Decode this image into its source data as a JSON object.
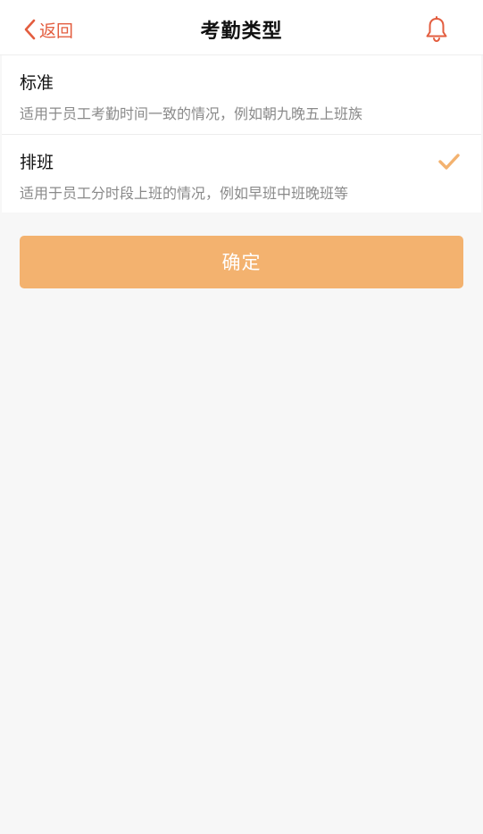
{
  "header": {
    "back_label": "返回",
    "title": "考勤类型",
    "right_icon": "bell-icon"
  },
  "options": [
    {
      "title": "标准",
      "description": "适用于员工考勤时间一致的情况，例如朝九晚五上班族",
      "selected": false
    },
    {
      "title": "排班",
      "description": "适用于员工分时段上班的情况，例如早班中班晚班等",
      "selected": true
    }
  ],
  "confirm_label": "确定",
  "colors": {
    "accent": "#e35d3f",
    "button": "#f3b26f",
    "check": "#f3b26f",
    "background": "#f7f7f7"
  }
}
